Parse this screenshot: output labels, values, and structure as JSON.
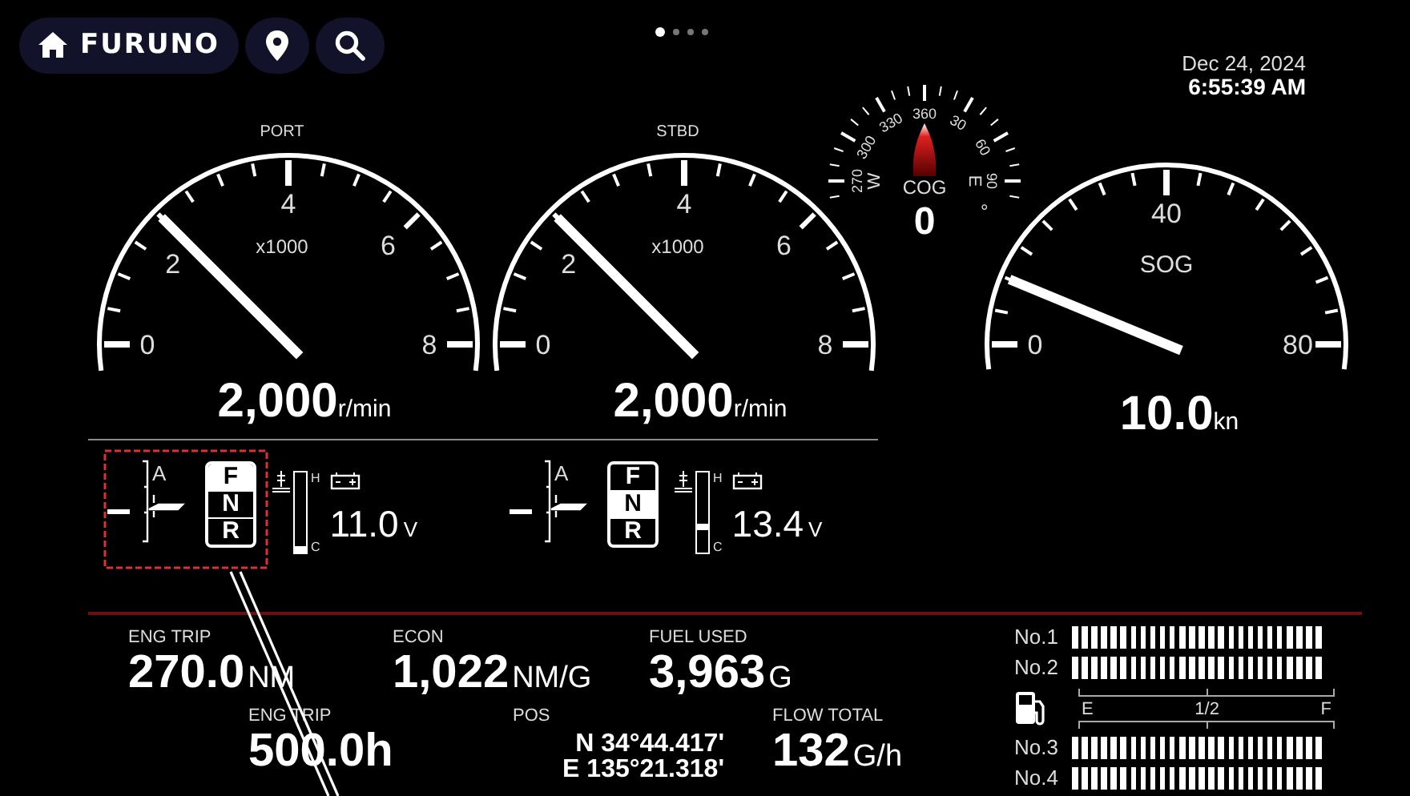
{
  "top_bar": {
    "brand": "FURUNO",
    "page_dots": [
      {
        "selected": true
      },
      {
        "selected": false
      },
      {
        "selected": false
      },
      {
        "selected": false
      }
    ]
  },
  "clock": {
    "date": "Dec 24, 2024",
    "time": "6:55:39 AM"
  },
  "rpm_gauges": [
    {
      "label": "PORT",
      "multiplier": "x1000",
      "ticks": [
        "0",
        "2",
        "4",
        "6",
        "8"
      ],
      "level": 0.25,
      "value": "2,000",
      "unit": "r/min"
    },
    {
      "label": "STBD",
      "multiplier": "x1000",
      "ticks": [
        "0",
        "2",
        "4",
        "6",
        "8"
      ],
      "level": 0.25,
      "value": "2,000",
      "unit": "r/min"
    }
  ],
  "compass": {
    "ticks": [
      "270",
      "300",
      "330",
      "360",
      "30",
      "60",
      "90"
    ],
    "cardinals": [
      "W",
      "E"
    ],
    "label": "COG",
    "value": "0",
    "unit": "°"
  },
  "sog_gauge": {
    "label": "SOG",
    "ticks": [
      "0",
      "40",
      "80"
    ],
    "level": 0.125,
    "value": "10.0",
    "unit": "kn"
  },
  "engines": [
    {
      "trim_label": "A",
      "gears": [
        {
          "label": "F",
          "selected": true
        },
        {
          "label": "N",
          "selected": false
        },
        {
          "label": "R",
          "selected": false
        }
      ],
      "temp_high": "H",
      "temp_low": "C",
      "level": 0.0,
      "voltage": "11.0",
      "voltage_unit": "V"
    },
    {
      "trim_label": "A",
      "gears": [
        {
          "label": "F",
          "selected": false
        },
        {
          "label": "N",
          "selected": true
        },
        {
          "label": "R",
          "selected": false
        }
      ],
      "temp_high": "H",
      "temp_low": "C",
      "level": 0.3,
      "voltage": "13.4",
      "voltage_unit": "V"
    }
  ],
  "readouts": [
    {
      "kind": "value",
      "label": "ENG TRIP",
      "value": "270.0",
      "unit": "NM"
    },
    {
      "kind": "value",
      "label": "ECON",
      "value": "1,022",
      "unit": "NM/G"
    },
    {
      "kind": "value",
      "label": "FUEL USED",
      "value": "3,963",
      "unit": "G"
    },
    {
      "kind": "value",
      "label": "ENG TRIP",
      "value": "500.0h"
    },
    {
      "kind": "position",
      "label": "POS",
      "lines": [
        "N 34°44.417'",
        "E 135°21.318'"
      ]
    },
    {
      "kind": "value",
      "label": "FLOW TOTAL",
      "value": "132",
      "unit": "G/h"
    }
  ],
  "tanks": {
    "upper": [
      {
        "name": "No.1",
        "level": 1
      },
      {
        "name": "No.2",
        "level": 1
      }
    ],
    "scale": [
      "E",
      "1/2",
      "F"
    ],
    "lower": [
      {
        "name": "No.3",
        "level": 1
      },
      {
        "name": "No.4",
        "level": 1
      }
    ]
  }
}
